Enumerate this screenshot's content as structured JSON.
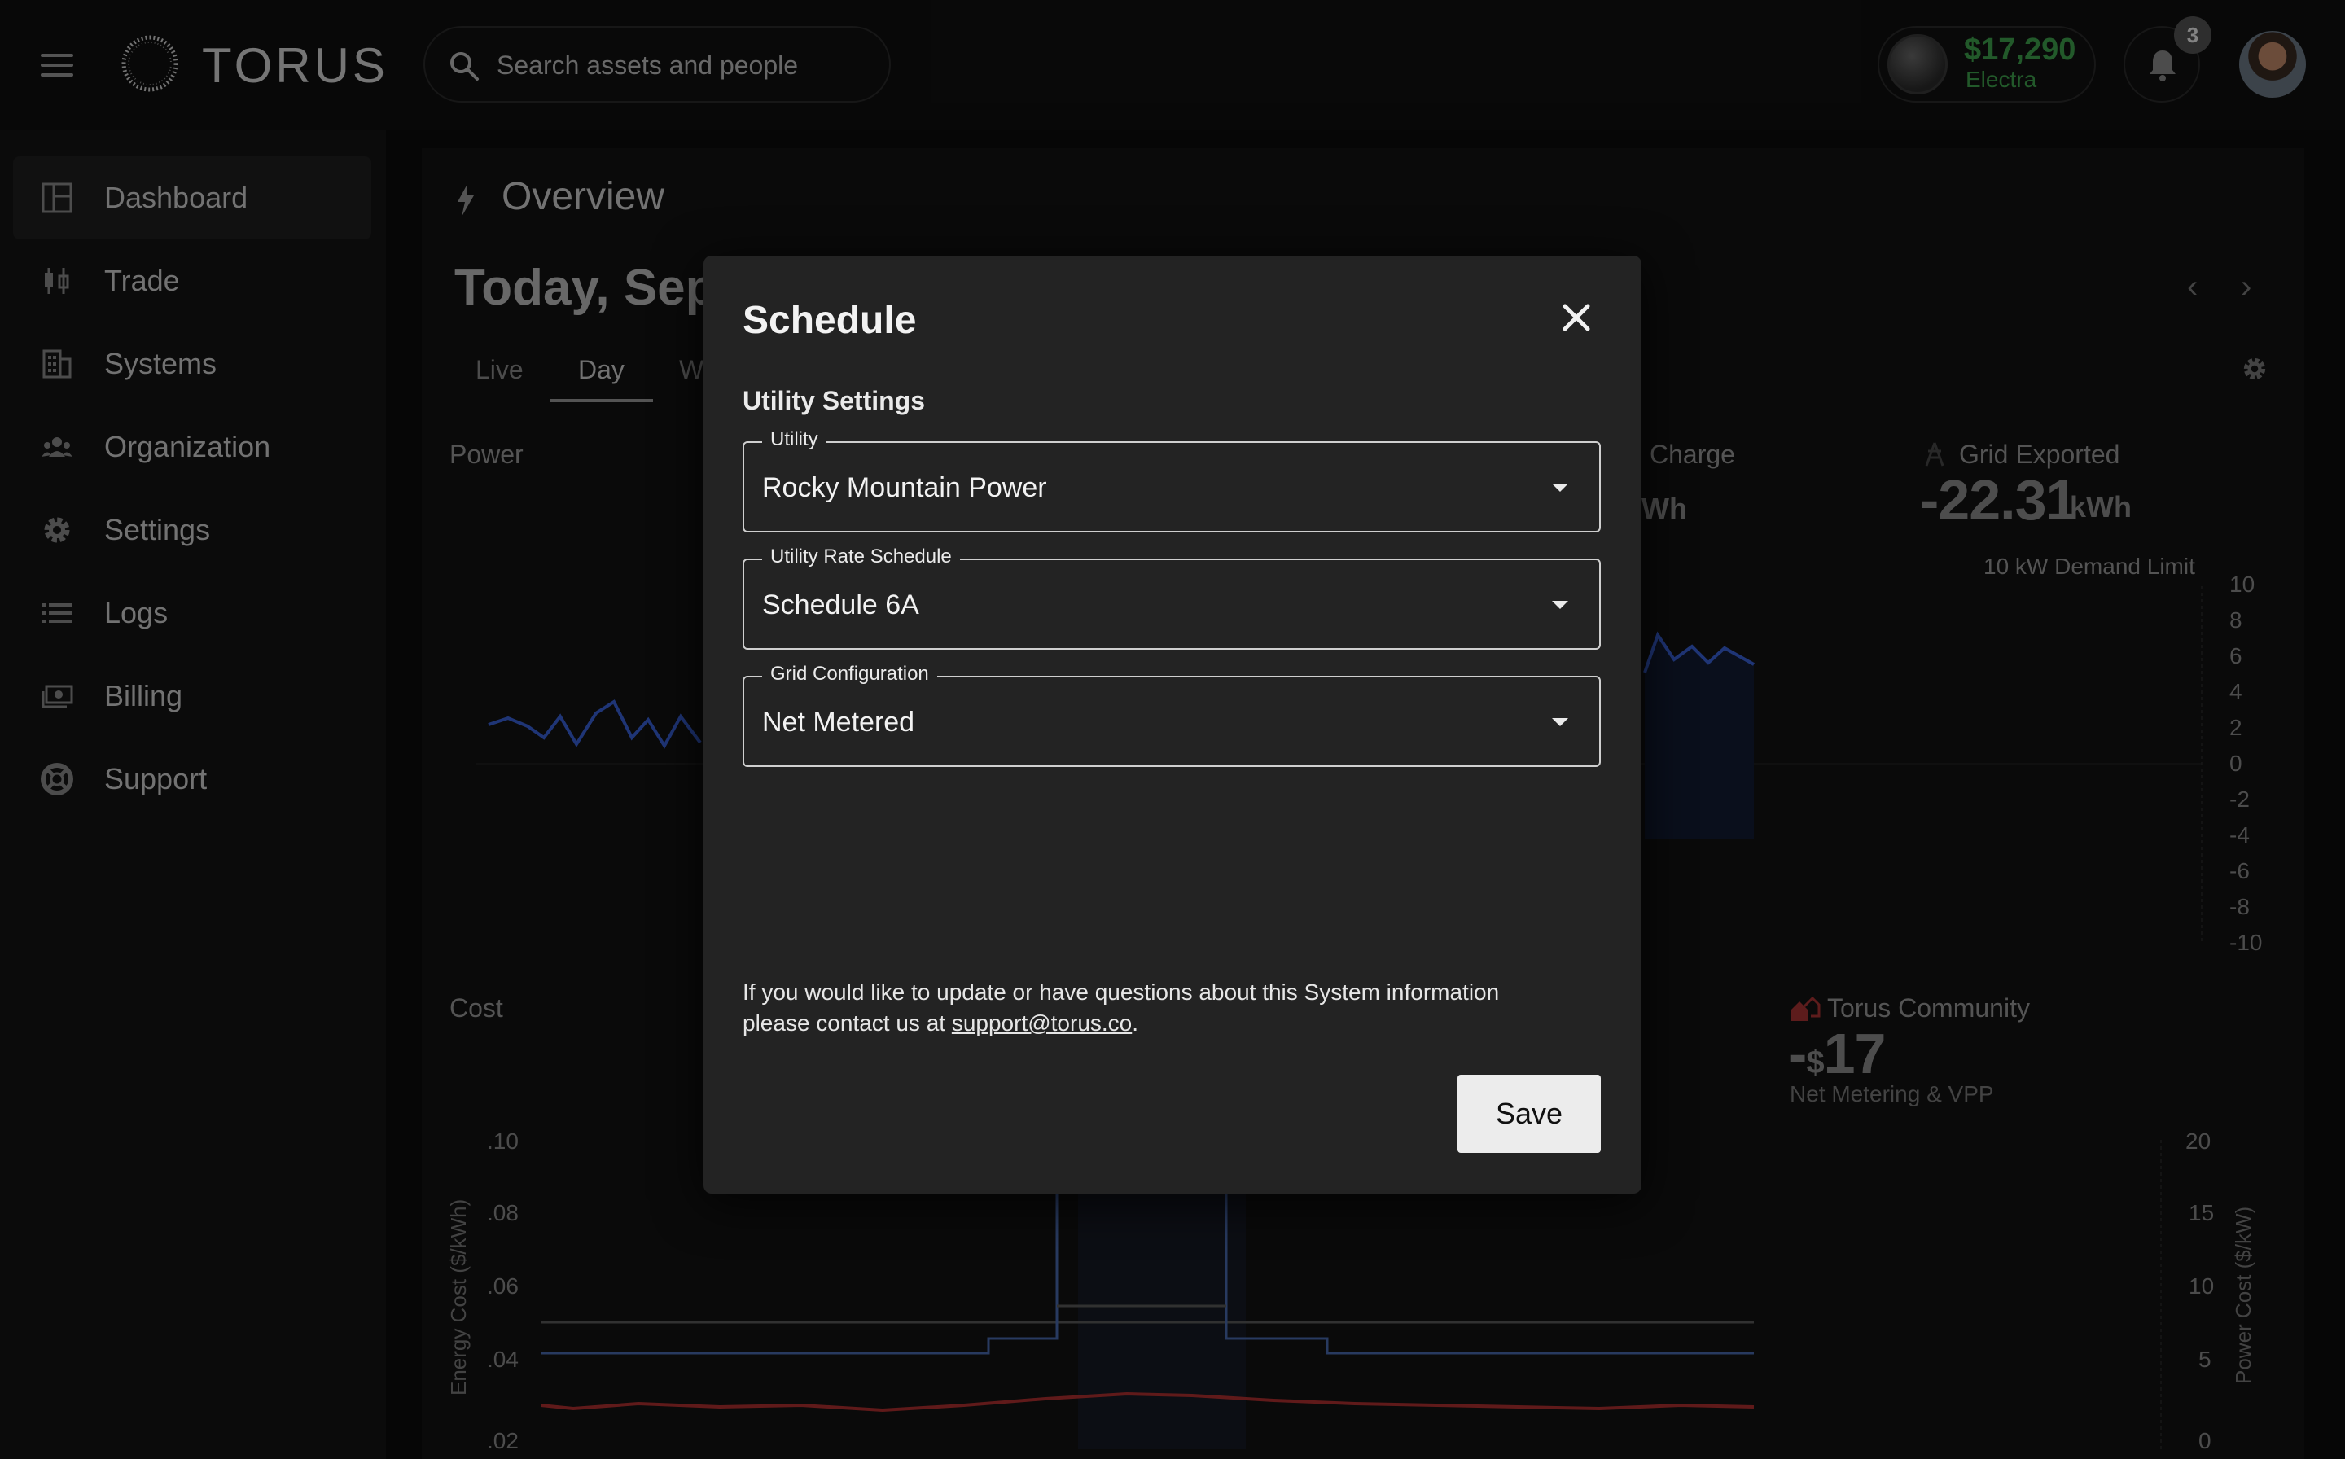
{
  "header": {
    "brand": "TORUS",
    "search_placeholder": "Search assets and people",
    "wallet_amount": "$17,290",
    "wallet_currency": "Electra",
    "notification_count": "3"
  },
  "sidebar": {
    "items": [
      {
        "label": "Dashboard",
        "icon": "dashboard-icon",
        "active": true
      },
      {
        "label": "Trade",
        "icon": "candlestick-icon"
      },
      {
        "label": "Systems",
        "icon": "building-icon"
      },
      {
        "label": "Organization",
        "icon": "group-icon"
      },
      {
        "label": "Settings",
        "icon": "gear-icon"
      },
      {
        "label": "Logs",
        "icon": "list-icon"
      },
      {
        "label": "Billing",
        "icon": "cash-icon"
      },
      {
        "label": "Support",
        "icon": "lifebuoy-icon"
      }
    ]
  },
  "page": {
    "title": "Overview",
    "date_heading": "Today, Sep",
    "tabs": [
      "Live",
      "Day",
      "W"
    ],
    "active_tab": "Day",
    "power_label": "Power",
    "charge_label": "Charge",
    "charge_unit": "Wh",
    "grid_exported_label": "Grid Exported",
    "grid_exported_value": "-22.31",
    "grid_exported_unit": "kWh",
    "demand_limit": "10 kW Demand Limit",
    "power_axis": [
      "10",
      "8",
      "6",
      "4",
      "2",
      "0",
      "-2",
      "-4",
      "-6",
      "-8",
      "-10"
    ],
    "cost_label": "Cost",
    "community_label": "Torus Community",
    "community_value_sign": "-",
    "community_value_currency": "$",
    "community_value": "17",
    "community_sub": "Net Metering & VPP",
    "energy_axis_label": "Energy Cost ($/kWh)",
    "energy_axis": [
      ".10",
      ".08",
      ".06",
      ".04",
      ".02"
    ],
    "power_cost_axis_label": "Power Cost ($/kW)",
    "power_cost_axis": [
      "20",
      "15",
      "10",
      "5",
      "0"
    ]
  },
  "modal": {
    "title": "Schedule",
    "section": "Utility Settings",
    "fields": [
      {
        "label": "Utility",
        "value": "Rocky Mountain Power"
      },
      {
        "label": "Utility Rate Schedule",
        "value": "Schedule 6A"
      },
      {
        "label": "Grid Configuration",
        "value": "Net Metered"
      }
    ],
    "info_text": "If you would like to update or have questions about this System information please contact us at",
    "info_email": "support@torus.co",
    "info_end": ".",
    "save_label": "Save"
  },
  "colors": {
    "wallet_green": "#3fa34d",
    "series_blue": "#3a62d8",
    "series_red": "#c0392b",
    "modal_bg": "#232323"
  }
}
